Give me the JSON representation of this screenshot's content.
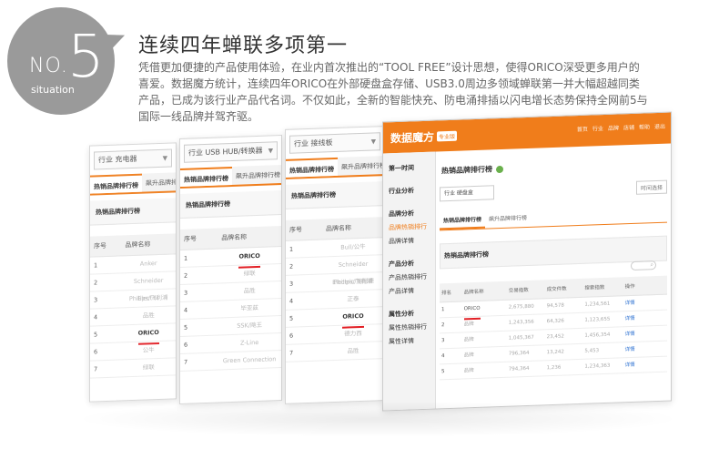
{
  "badge": {
    "no": "NO.",
    "num": "5",
    "sub": "situation"
  },
  "headline": "连续四年蝉联多项第一",
  "paragraph": "凭借更加便捷的产品使用体验，在业内首次推出的“TOOL FREE”设计思想，使得ORICO深受更多用户的喜爱。数据魔方统计，连续四年ORICO在外部硬盘盒存储、USB3.0周边多领域蝉联第一并大幅超越同类产品，已成为该行业产品代名词。不仅如此，全新的智能快充、防电涌排插以闪电增长态势保持全网前5与国际一线品牌并驾齐驱。",
  "panels": [
    {
      "select": "行业 充电器",
      "tabs": [
        "热销品牌排行榜",
        "飙升品牌排行榜"
      ],
      "section": "热销品牌排行榜",
      "headers": [
        "序号",
        "品牌名称"
      ],
      "rows": [
        {
          "idx": "1",
          "name": "Anker"
        },
        {
          "idx": "2",
          "name": "Schneider Electric"
        },
        {
          "idx": "3",
          "name": "Philips/飞利浦"
        },
        {
          "idx": "4",
          "name": "品胜"
        },
        {
          "idx": "5",
          "name": "ORICO"
        },
        {
          "idx": "6",
          "name": "公牛"
        },
        {
          "idx": "7",
          "name": "绿联"
        }
      ]
    },
    {
      "select": "行业 USB HUB/转换器",
      "tabs": [
        "热销品牌排行榜",
        "飙升品牌排行榜"
      ],
      "section": "热销品牌排行榜",
      "headers": [
        "序号",
        "品牌名称"
      ],
      "rows": [
        {
          "idx": "1",
          "name": "ORICO"
        },
        {
          "idx": "2",
          "name": "绿联"
        },
        {
          "idx": "3",
          "name": "品胜"
        },
        {
          "idx": "4",
          "name": "毕亚兹"
        },
        {
          "idx": "5",
          "name": "SSK/飚王"
        },
        {
          "idx": "6",
          "name": "Z-Line"
        },
        {
          "idx": "7",
          "name": "Green Connection"
        }
      ]
    },
    {
      "select": "行业 接线板",
      "tabs": [
        "热销品牌排行榜",
        "飙升品牌排行榜"
      ],
      "section": "热销品牌排行榜",
      "headers": [
        "序号",
        "品牌名称"
      ],
      "rows": [
        {
          "idx": "1",
          "name": "Bull/公牛"
        },
        {
          "idx": "2",
          "name": "Schneider Electric/施耐德"
        },
        {
          "idx": "3",
          "name": "Philips/飞利浦"
        },
        {
          "idx": "4",
          "name": "正泰"
        },
        {
          "idx": "5",
          "name": "ORICO"
        },
        {
          "idx": "6",
          "name": "德力西"
        },
        {
          "idx": "7",
          "name": "品胜"
        }
      ]
    }
  ],
  "dashboard": {
    "title": "数据魔方",
    "tag": "专业版",
    "nav": [
      "首页",
      "行业",
      "品牌",
      "店铺",
      "帮助",
      "退出"
    ],
    "sidebar": [
      {
        "label": "第一时间",
        "type": "group"
      },
      {
        "label": "行业分析",
        "type": "group",
        "gap": true
      },
      {
        "label": "品牌分析",
        "type": "group",
        "gap": true
      },
      {
        "label": "品牌热销排行",
        "type": "active"
      },
      {
        "label": "品牌详情",
        "type": "item"
      },
      {
        "label": "产品分析",
        "type": "group",
        "gap": true
      },
      {
        "label": "产品热销排行",
        "type": "item"
      },
      {
        "label": "产品详情",
        "type": "item"
      },
      {
        "label": "属性分析",
        "type": "group",
        "gap": true
      },
      {
        "label": "属性热销排行",
        "type": "item"
      },
      {
        "label": "属性详情",
        "type": "item"
      }
    ],
    "content_title": "热销品牌排行榜",
    "filter_select": "行业 硬盘盒",
    "date": "时间选择",
    "tabs": [
      "热销品牌排行榜",
      "飙升品牌排行榜"
    ],
    "section": "热销品牌排行榜",
    "search_icon": "search-icon",
    "headers": [
      "排名",
      "品牌名称",
      "交易指数",
      "成交件数",
      "搜索指数",
      "操作"
    ],
    "rows": [
      {
        "rank": "1",
        "brand": "ORICO",
        "v1": "2,675,880",
        "v2": "94,578",
        "v3": "1,234,561",
        "op": "详情"
      },
      {
        "rank": "2",
        "brand": "品牌",
        "v1": "1,243,356",
        "v2": "64,326",
        "v3": "1,123,655",
        "op": "详情"
      },
      {
        "rank": "3",
        "brand": "品牌",
        "v1": "1,045,367",
        "v2": "23,452",
        "v3": "1,456,354",
        "op": "详情"
      },
      {
        "rank": "4",
        "brand": "品牌",
        "v1": "796,364",
        "v2": "13,242",
        "v3": "5,453",
        "op": "详情"
      },
      {
        "rank": "5",
        "brand": "品牌",
        "v1": "794,364",
        "v2": "1,236",
        "v3": "1,234,363",
        "op": "详情"
      }
    ],
    "accent": "#f07d1b",
    "highlight_color": "#e21e24"
  }
}
